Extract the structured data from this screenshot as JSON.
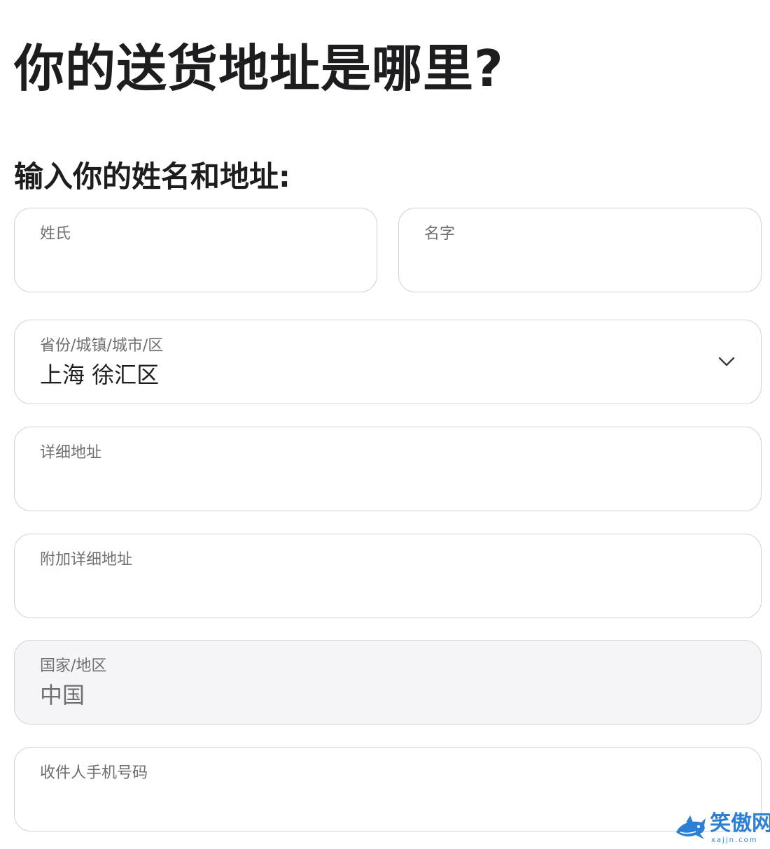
{
  "page": {
    "title": "你的送货地址是哪里?",
    "section_title": "输入你的姓名和地址:"
  },
  "form": {
    "last_name": {
      "label": "姓氏",
      "value": ""
    },
    "first_name": {
      "label": "名字",
      "value": ""
    },
    "region": {
      "label": "省份/城镇/城市/区",
      "value": "上海 徐汇区",
      "icon": "chevron-down-icon"
    },
    "street": {
      "label": "详细地址",
      "value": ""
    },
    "street2": {
      "label": "附加详细地址",
      "value": ""
    },
    "country": {
      "label": "国家/地区",
      "value": "中国",
      "disabled": true
    },
    "phone": {
      "label": "收件人手机号码",
      "value": ""
    }
  },
  "watermark": {
    "text": "笑傲网",
    "url": "xajjn.com",
    "icon": "shark-logo-icon"
  },
  "colors": {
    "text": "#1d1d1f",
    "label": "#6e6e73",
    "border": "#d2d2d7",
    "disabled_bg": "#f5f5f7",
    "watermark": "#2b7fd4"
  }
}
